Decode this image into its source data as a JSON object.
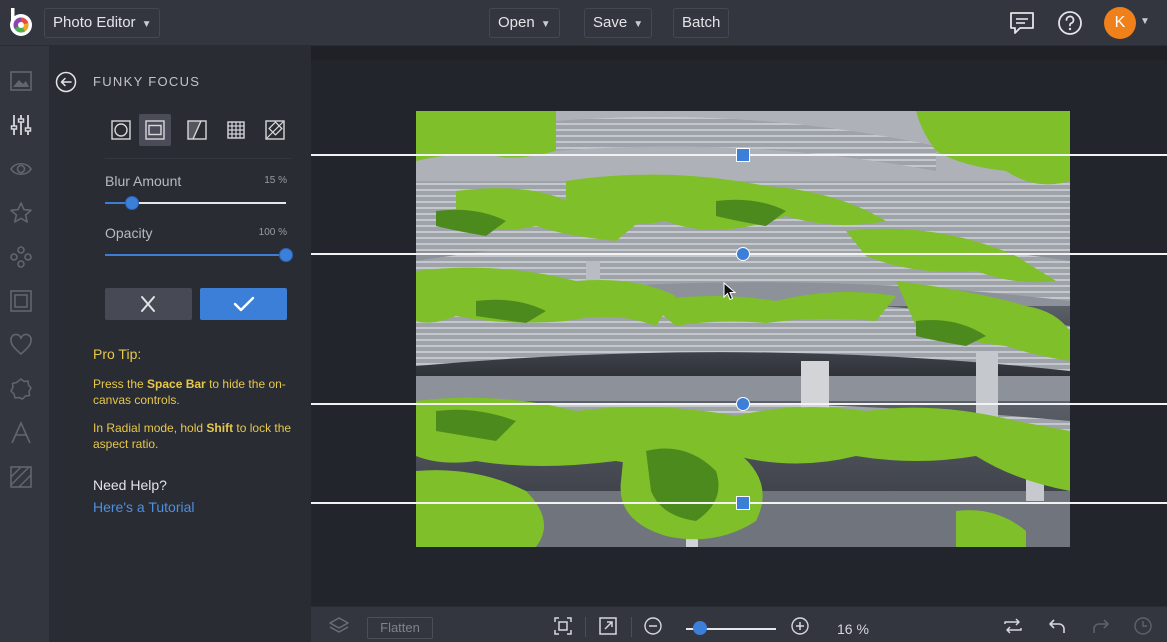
{
  "topbar": {
    "app_menu_label": "Photo Editor",
    "open_label": "Open",
    "save_label": "Save",
    "batch_label": "Batch",
    "avatar_initial": "K"
  },
  "rail": {
    "items": [
      "image-icon",
      "adjust-icon",
      "eye-icon",
      "star-icon",
      "effects-icon",
      "frame-icon",
      "heart-icon",
      "badge-icon",
      "text-icon",
      "texture-icon"
    ]
  },
  "panel": {
    "title": "FUNKY FOCUS",
    "modes": [
      "radial-mode-icon",
      "linear-mode-icon",
      "split-mode-icon",
      "grid-mode-icon",
      "tilt-mode-icon"
    ],
    "active_mode": 1,
    "blur": {
      "label": "Blur Amount",
      "value_text": "15 %",
      "fraction": 0.15
    },
    "opacity": {
      "label": "Opacity",
      "value_text": "100 %",
      "fraction": 1.0
    },
    "tip_title": "Pro Tip:",
    "tip1": {
      "pre": "Press the ",
      "bold": "Space Bar",
      "post": " to hide the on-canvas controls."
    },
    "tip2": {
      "pre": "In Radial mode, hold ",
      "bold": "Shift",
      "post": " to lock the aspect ratio."
    },
    "help_title": "Need Help?",
    "help_link": "Here's a Tutorial"
  },
  "bottombar": {
    "flatten_label": "Flatten",
    "zoom_text": "16 %",
    "zoom_fraction": 0.16
  },
  "colors": {
    "accent": "#3b7fd9",
    "tip": "#e6c84a",
    "avatar": "#f0811a"
  }
}
